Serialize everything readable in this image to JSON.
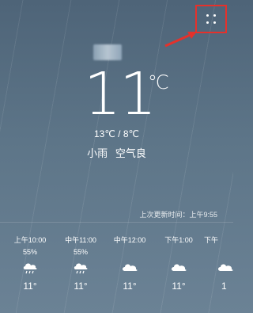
{
  "top": {
    "menu_icon": "more-dots-icon",
    "annotation_arrow": "red-arrow"
  },
  "current": {
    "temperature": "11",
    "unit": "℃",
    "range": "13℃ / 8℃",
    "condition": "小雨",
    "air_quality": "空气良"
  },
  "last_update": "上次更新时间：上午9:55",
  "hourly": [
    {
      "time": "上午10:00",
      "humidity": "55%",
      "icon": "rain-cloud-icon",
      "temp": "11°"
    },
    {
      "time": "中午11:00",
      "humidity": "55%",
      "icon": "rain-cloud-icon",
      "temp": "11°"
    },
    {
      "time": "中午12:00",
      "humidity": "",
      "icon": "cloud-icon",
      "temp": "11°"
    },
    {
      "time": "下午1:00",
      "humidity": "",
      "icon": "cloud-icon",
      "temp": "11°"
    },
    {
      "time": "下午",
      "humidity": "",
      "icon": "cloud-icon",
      "temp": "1"
    }
  ],
  "colors": {
    "highlight": "#e5312b",
    "text": "#ffffff"
  }
}
